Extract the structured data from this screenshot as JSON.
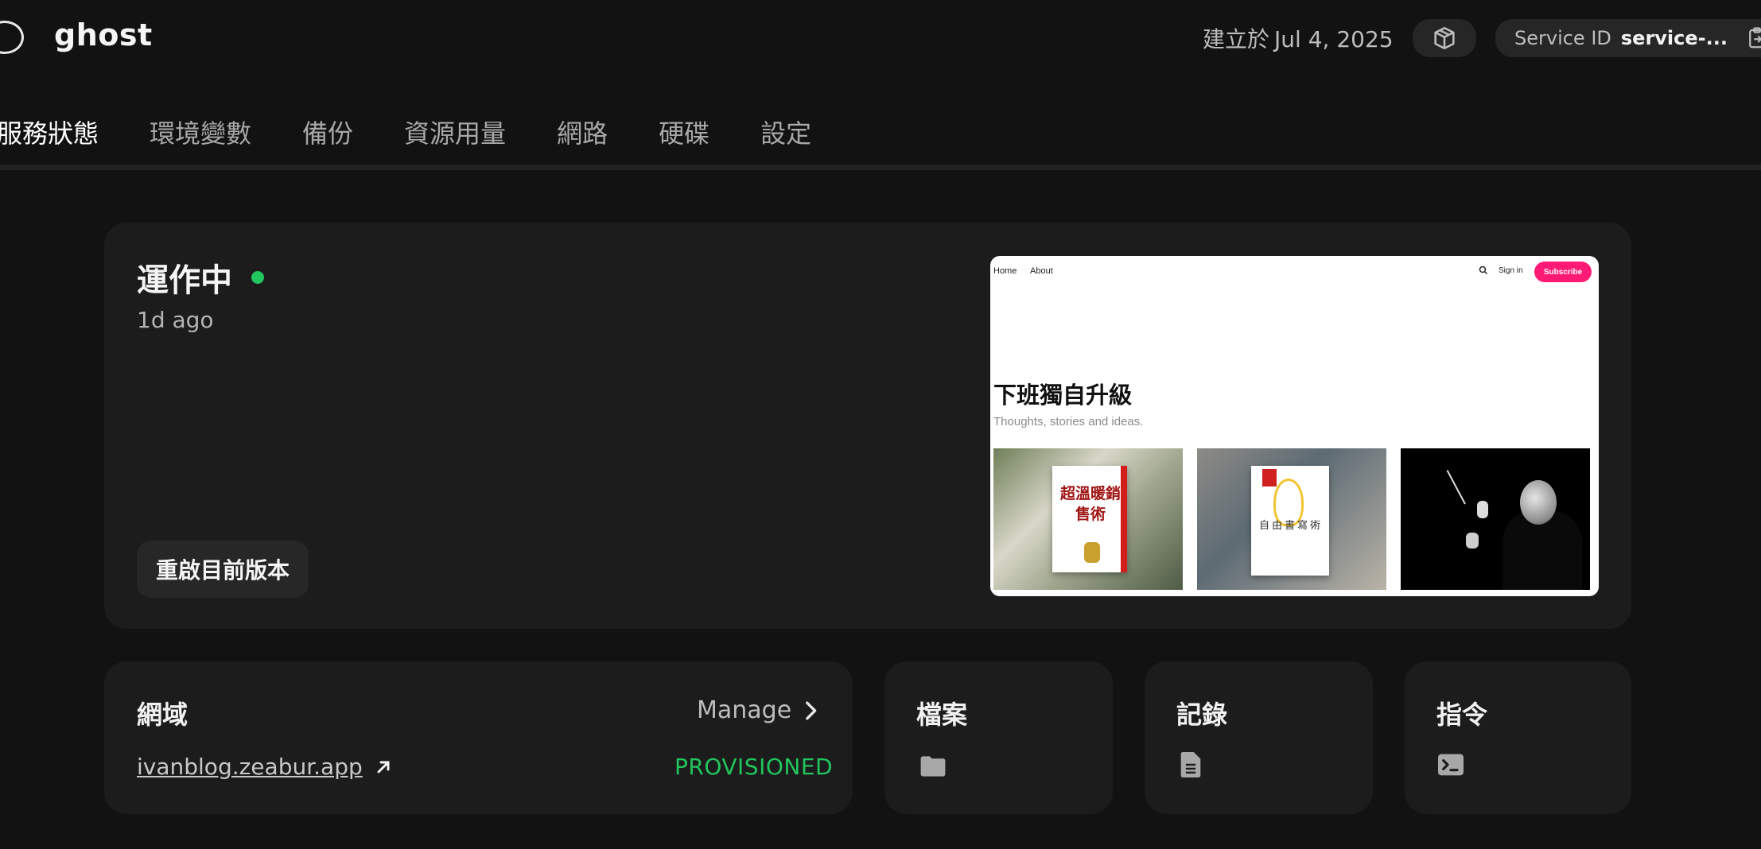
{
  "header": {
    "app_name": "ghost",
    "created_label": "建立於",
    "created_date": "Jul 4, 2025",
    "service_id_label": "Service ID",
    "service_id_value": "service-..."
  },
  "tabs": [
    {
      "label": "服務狀態",
      "active": true
    },
    {
      "label": "環境變數"
    },
    {
      "label": "備份"
    },
    {
      "label": "資源用量"
    },
    {
      "label": "網路"
    },
    {
      "label": "硬碟"
    },
    {
      "label": "設定"
    }
  ],
  "status": {
    "title": "運作中",
    "time_ago": "1d ago",
    "restart_label": "重啟目前版本",
    "dot_color": "#22c55e"
  },
  "preview": {
    "nav": {
      "home": "Home",
      "about": "About",
      "signin": "Sign in",
      "subscribe": "Subscribe"
    },
    "site_title": "下班獨自升級",
    "tagline": "Thoughts, stories and ideas.",
    "books": {
      "book1_title": "超溫暖銷售術",
      "book2_title": "自由書寫術"
    }
  },
  "domain": {
    "title": "網域",
    "manage_label": "Manage",
    "url": "ivanblog.zeabur.app",
    "status": "PROVISIONED",
    "status_color": "#22c55e"
  },
  "files": {
    "title": "檔案",
    "icon": "folder-icon"
  },
  "logs": {
    "title": "記錄",
    "icon": "document-icon"
  },
  "commands": {
    "title": "指令",
    "icon": "terminal-icon"
  }
}
